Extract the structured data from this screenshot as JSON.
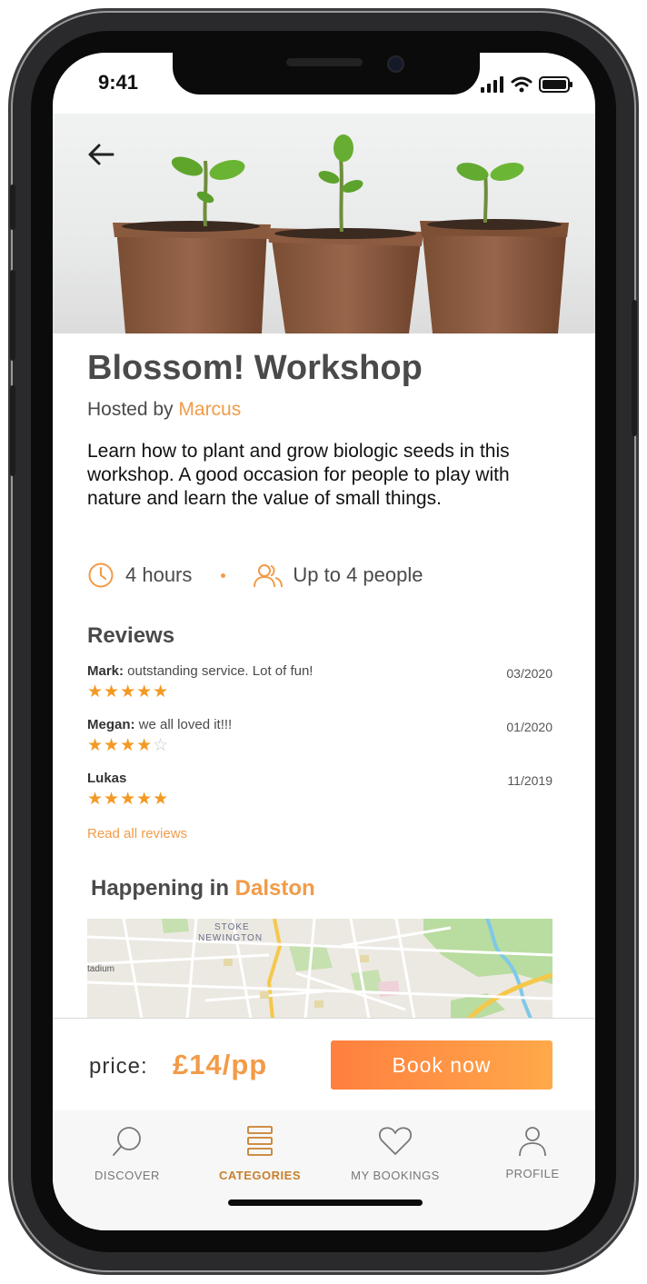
{
  "status_bar": {
    "time": "9:41"
  },
  "hero": {
    "image_alt": "three seedlings growing in peat pots"
  },
  "workshop": {
    "title": "Blossom! Workshop",
    "hosted_prefix": "Hosted by ",
    "host": "Marcus",
    "description": "Learn how to plant and grow biologic seeds in this workshop. A good occasion for people to play with nature and learn the value of small things.",
    "duration": "4 hours",
    "capacity": "Up to 4 people"
  },
  "reviews": {
    "heading": "Reviews",
    "items": [
      {
        "name": "Mark:",
        "text": " outstanding service. Lot of fun!",
        "date": "03/2020",
        "stars_filled": "★★★★★",
        "stars_empty": "",
        "rating": 5
      },
      {
        "name": "Megan:",
        "text": " we all loved it!!!",
        "date": "01/2020",
        "stars_filled": "★★★★",
        "stars_empty": "☆",
        "rating": 4
      },
      {
        "name": "Lukas",
        "text": "",
        "date": "11/2019",
        "stars_filled": "★★★★★",
        "stars_empty": "",
        "rating": 5
      }
    ],
    "read_all": "Read all reviews"
  },
  "location": {
    "prefix": "Happening in ",
    "place": "Dalston",
    "map_labels": {
      "area_line1": "STOKE",
      "area_line2": "NEWINGTON",
      "left": "tadium"
    }
  },
  "booking": {
    "price_label": "price:",
    "price_value": "£14/pp",
    "book_label": "Book now"
  },
  "tabbar": {
    "tabs": [
      {
        "label": "DISCOVER",
        "icon": "search-icon",
        "active": false
      },
      {
        "label": "CATEGORIES",
        "icon": "categories-icon",
        "active": true
      },
      {
        "label": "MY BOOKINGS",
        "icon": "heart-icon",
        "active": false
      },
      {
        "label": "PROFILE",
        "icon": "person-icon",
        "active": false
      }
    ]
  },
  "colors": {
    "accent": "#f29b48",
    "star": "#f49922",
    "active_tab": "#c8802d",
    "text": "#4a4a4a"
  }
}
